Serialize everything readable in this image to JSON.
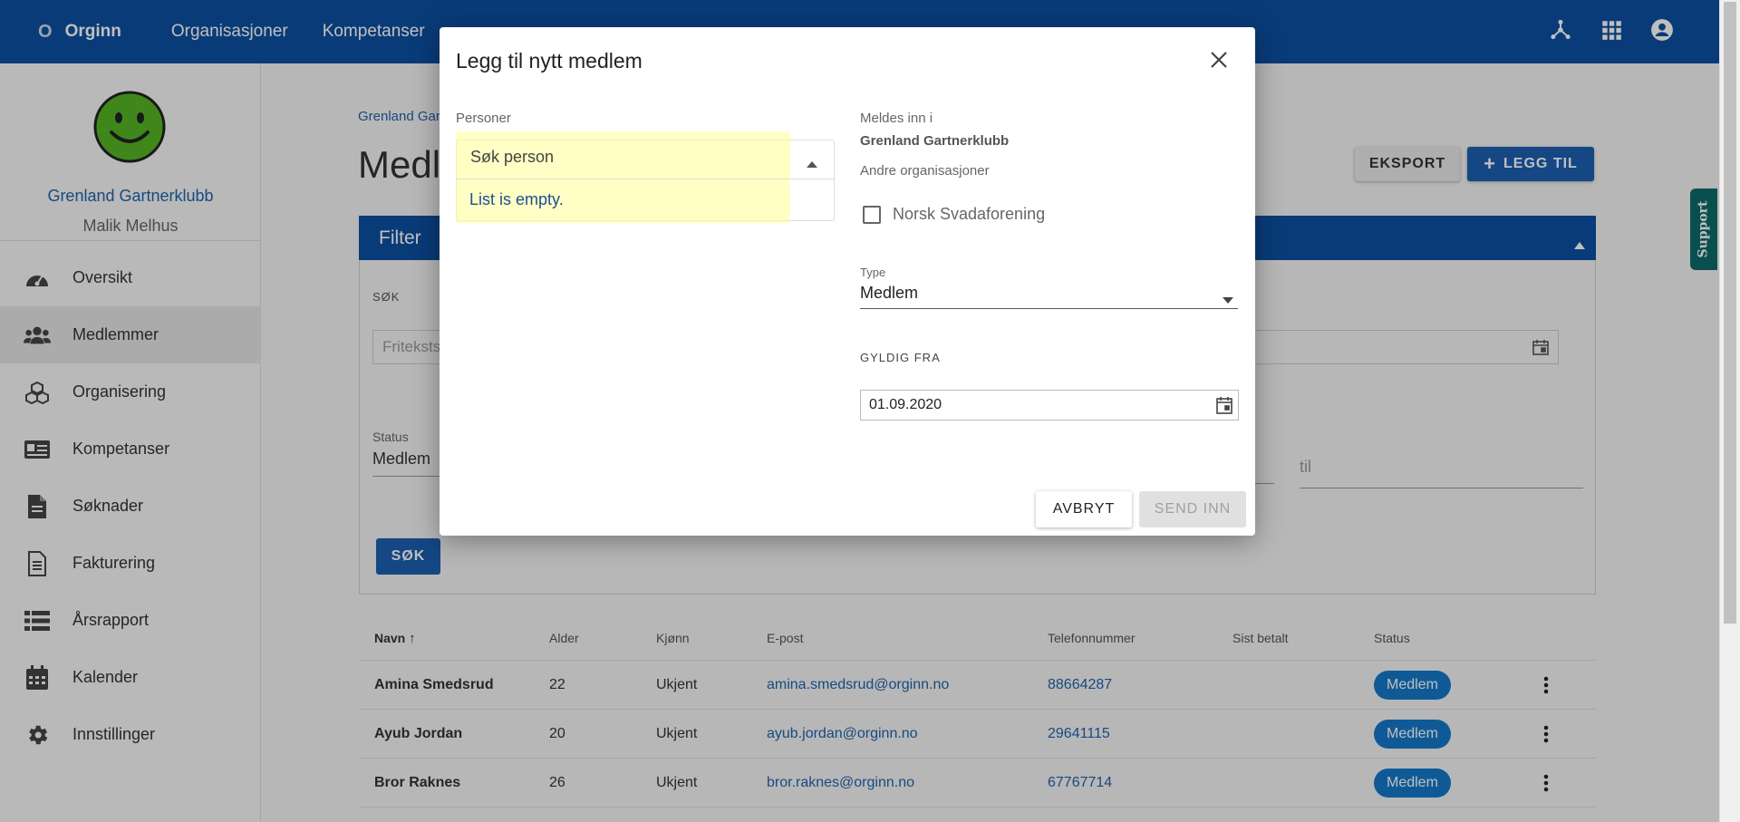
{
  "topbar": {
    "logo_mark": "O",
    "logo_text": "Orginn",
    "nav": [
      "Organisasjoner",
      "Kompetanser"
    ],
    "icons": [
      "hub-icon",
      "apps-grid-icon",
      "account-circle-icon"
    ]
  },
  "sidebar": {
    "org_name": "Grenland Gartnerklubb",
    "user_name": "Malik Melhus",
    "items": [
      {
        "label": "Oversikt",
        "icon": "dashboard-icon"
      },
      {
        "label": "Medlemmer",
        "icon": "people-icon",
        "active": true
      },
      {
        "label": "Organisering",
        "icon": "cubes-icon"
      },
      {
        "label": "Kompetanser",
        "icon": "id-card-icon"
      },
      {
        "label": "Søknader",
        "icon": "document-icon"
      },
      {
        "label": "Fakturering",
        "icon": "invoice-icon"
      },
      {
        "label": "Årsrapport",
        "icon": "list-icon"
      },
      {
        "label": "Kalender",
        "icon": "calendar-icon"
      },
      {
        "label": "Innstillinger",
        "icon": "gear-icon"
      }
    ]
  },
  "main": {
    "breadcrumb": "Grenland Gar",
    "title": "Medle",
    "export_label": "EKSPORT",
    "add_label": "LEGG TIL",
    "filter": {
      "title": "Filter",
      "search_label": "SØK",
      "search_placeholder": "Friteksts",
      "status_label": "Status",
      "status_value": "Medlem",
      "til_placeholder": "til",
      "search_button": "SØK"
    },
    "table": {
      "headers": [
        "Navn",
        "Alder",
        "Kjønn",
        "E-post",
        "Telefonnummer",
        "Sist betalt",
        "Status"
      ],
      "rows": [
        {
          "name": "Amina Smedsrud",
          "age": "22",
          "gender": "Ukjent",
          "email": "amina.smedsrud@orginn.no",
          "phone": "88664287",
          "paid": "",
          "status": "Medlem"
        },
        {
          "name": "Ayub Jordan",
          "age": "20",
          "gender": "Ukjent",
          "email": "ayub.jordan@orginn.no",
          "phone": "29641115",
          "paid": "",
          "status": "Medlem"
        },
        {
          "name": "Bror Raknes",
          "age": "26",
          "gender": "Ukjent",
          "email": "bror.raknes@orginn.no",
          "phone": "67767714",
          "paid": "",
          "status": "Medlem"
        }
      ]
    }
  },
  "support": {
    "label": "Support"
  },
  "dialog": {
    "title": "Legg til nytt medlem",
    "persons_label": "Personer",
    "person_placeholder": "Søk person",
    "list_empty": "List is empty.",
    "meldes_label": "Meldes inn i",
    "org_value": "Grenland Gartnerklubb",
    "other_orgs_label": "Andre organisasjoner",
    "other_org": "Norsk Svadaforening",
    "type_label": "Type",
    "type_value": "Medlem",
    "valid_from_label": "GYLDIG FRA",
    "valid_from_value": "01.09.2020",
    "cancel_label": "AVBRYT",
    "submit_label": "SEND INN"
  },
  "colors": {
    "brand": "#0d4fa0",
    "accent": "#1b5fb0",
    "badge": "#1478c8",
    "link": "#1f63ad",
    "support": "#0c6a6a"
  }
}
